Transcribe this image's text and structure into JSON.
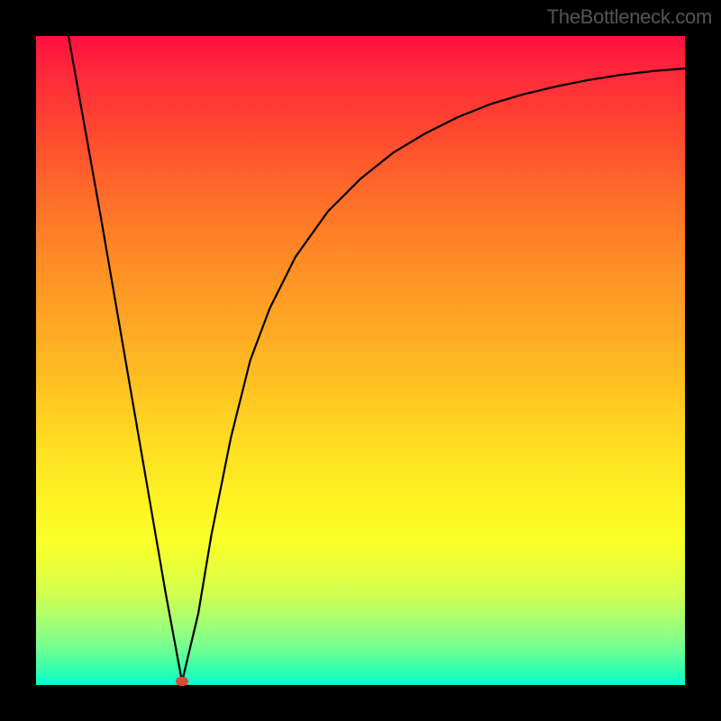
{
  "watermark": "TheBottleneck.com",
  "chart_data": {
    "type": "line",
    "title": "",
    "xlabel": "",
    "ylabel": "",
    "xlim": [
      0,
      100
    ],
    "ylim": [
      0,
      100
    ],
    "grid": false,
    "minimum": {
      "x": 22.5,
      "y": 0.5
    },
    "series": [
      {
        "name": "curve",
        "x": [
          5,
          10,
          15,
          20,
          22.5,
          25,
          27,
          30,
          33,
          36,
          40,
          45,
          50,
          55,
          60,
          65,
          70,
          75,
          80,
          85,
          90,
          95,
          100
        ],
        "y": [
          100,
          72,
          43,
          14,
          0.5,
          11,
          23,
          38,
          50,
          58,
          66,
          73,
          78,
          82,
          85,
          87.5,
          89.5,
          91,
          92.2,
          93.2,
          94,
          94.6,
          95
        ]
      }
    ],
    "colors": {
      "curve": "#000000",
      "marker": "#d84a3a",
      "gradient_top": "#ff1040",
      "gradient_bottom": "#00ffd4",
      "frame": "#000000"
    }
  }
}
